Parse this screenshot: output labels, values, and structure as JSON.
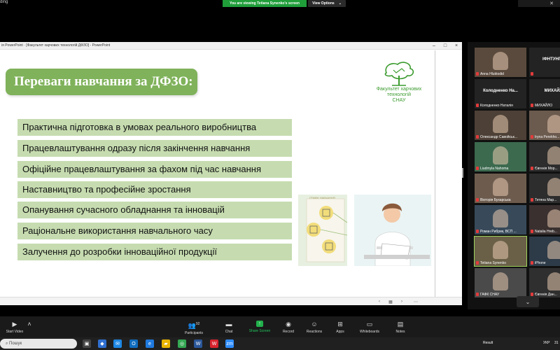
{
  "top": {
    "left_fragment": "ding",
    "banner": "You are viewing Tetiana Synenko's screen",
    "view_options": "View Options",
    "view_options_chevron": "⌄"
  },
  "ppt": {
    "title": "ія PowerPoint · [Факультет харчових технологій ДФЗО] - PowerPoint",
    "controls": [
      "–",
      "□",
      "×"
    ],
    "slide": {
      "title": "Переваги навчання за ДФЗО:",
      "logo_text_1": "Факультет харчових",
      "logo_text_2": "технологій",
      "logo_text_3": "СНАУ",
      "benefits": [
        "Практична підготовка в умовах реального виробництва",
        "Працевлаштування одразу після закінчення навчання",
        "Офіційне працевлаштування за фахом під час навчання",
        "Наставництво та професійне зростання",
        "Опанування сучасного обладнання та інновацій",
        "Раціональне використання навчального часу",
        "Залучення до розробки інноваційної продукції"
      ],
      "illustration_label": "ГРАФІК НАВЧАННЯ"
    },
    "status_icons": [
      "‹",
      "▦",
      "›",
      "⋯"
    ]
  },
  "gallery": {
    "tiles": [
      {
        "name": "Anna Hluktodid",
        "big": ""
      },
      {
        "name": "",
        "big": "ІФНТУНГ КЦ"
      },
      {
        "name": "Колодненко Наталія",
        "big": "Колодненко На..."
      },
      {
        "name": "МИХАЙЛО",
        "big": "МИХАЙЛО"
      },
      {
        "name": "Олександр Савойськ...",
        "big": ""
      },
      {
        "name": "Iryna Perekho...",
        "big": ""
      },
      {
        "name": "Liudmyla Nahoma",
        "big": ""
      },
      {
        "name": "Євгенія Мор...",
        "big": ""
      },
      {
        "name": "Вікторія Бухарська",
        "big": ""
      },
      {
        "name": "Тетяна Мар...",
        "big": ""
      },
      {
        "name": "Роман Рибрик, ВСП ...",
        "big": ""
      },
      {
        "name": "Natalia Hreb...",
        "big": ""
      },
      {
        "name": "Tetiana Synenko",
        "big": ""
      },
      {
        "name": "iPhone",
        "big": ""
      },
      {
        "name": "ГАФК СНАУ",
        "big": ""
      },
      {
        "name": "Євгенія Дан...",
        "big": ""
      }
    ],
    "chevron": "⌄"
  },
  "toolbar": {
    "start_video": "Start Video",
    "participants": "Participants",
    "participants_count": "92",
    "chat": "Chat",
    "share_screen": "Share Screen",
    "record": "Record",
    "reactions": "Reactions",
    "apps": "Apps",
    "whiteboards": "Whiteboards",
    "notes": "Notes"
  },
  "taskbar": {
    "search": "Пошук",
    "result": "Result",
    "lang": "УКР",
    "clock": "31"
  },
  "colors": {
    "slide_green": "#7fb25a",
    "benefit_green": "#c6dcb0",
    "zoom_green": "#22b14c"
  }
}
